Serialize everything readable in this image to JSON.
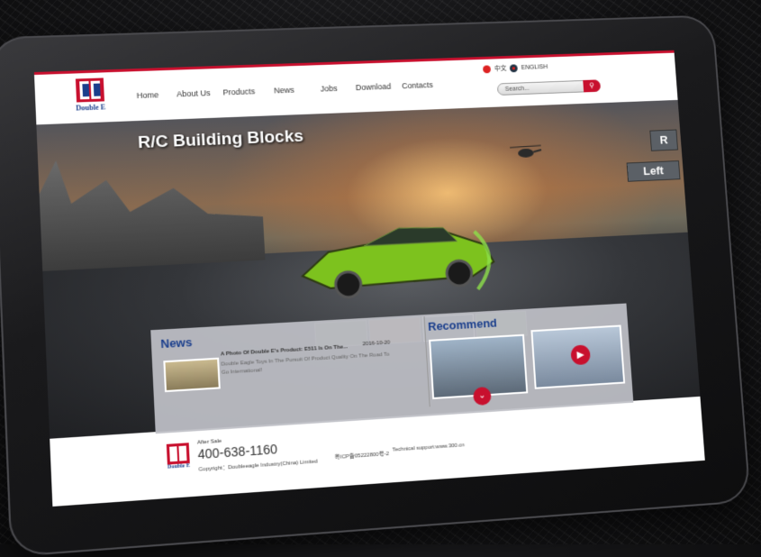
{
  "brand": {
    "logo_text": "Double E"
  },
  "nav": {
    "items": [
      "Home",
      "About Us",
      "Products",
      "News",
      "Jobs",
      "Download",
      "Contacts"
    ]
  },
  "lang": {
    "zh": "中文",
    "en": "ENGLISH"
  },
  "search": {
    "placeholder": "Search..."
  },
  "hero": {
    "title": "R/C Building Blocks",
    "sign_left": "Left",
    "sign_right": "R"
  },
  "news": {
    "heading": "News",
    "item_title": "A Photo Of Double E's Product: E511 Is On The...",
    "item_date": "2016-10-20",
    "item_desc": "Double Eagle Toys In The Pursuit Of Product Quality On The Road To Go International!"
  },
  "recommend": {
    "heading": "Recommend"
  },
  "footer": {
    "after_sale_label": "After Sale",
    "phone": "400-638-1160",
    "copyright": "Copyright：Doubleeagle Industry(China) Limited",
    "icp": "粤ICP备05222800号-2",
    "tech": "Technical support:www.300.cn"
  },
  "colors": {
    "accent": "#c8102e",
    "brand_blue": "#1a3e8c"
  }
}
